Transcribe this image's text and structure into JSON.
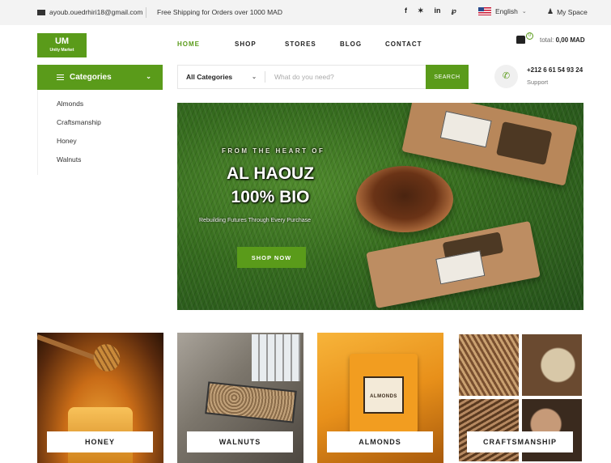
{
  "topbar": {
    "email": "ayoub.ouedrhiri18@gmail.com",
    "shipping": "Free Shipping for Orders over 1000 MAD",
    "social": [
      {
        "name": "facebook-icon",
        "glyph": "f"
      },
      {
        "name": "twitter-icon",
        "glyph": "✶"
      },
      {
        "name": "linkedin-icon",
        "glyph": "in"
      },
      {
        "name": "pinterest-icon",
        "glyph": "℘"
      }
    ],
    "language": "English",
    "account": "My Space"
  },
  "logo": {
    "mark": "UM",
    "name": "Unity Market"
  },
  "nav": [
    {
      "label": "HOME",
      "active": true
    },
    {
      "label": "SHOP",
      "active": false
    },
    {
      "label": "STORES",
      "active": false
    },
    {
      "label": "BLOG",
      "active": false
    },
    {
      "label": "CONTACT",
      "active": false
    }
  ],
  "cart": {
    "count": "0",
    "total_label": "total:",
    "total_value": "0,00 MAD"
  },
  "categories": {
    "title": "Categories",
    "items": [
      "Almonds",
      "Craftsmanship",
      "Honey",
      "Walnuts"
    ]
  },
  "search": {
    "category": "All Categories",
    "placeholder": "What do you need?",
    "button": "SEARCH"
  },
  "support": {
    "phone": "+212 6 61 54 93 24",
    "label": "Support"
  },
  "hero": {
    "eyebrow": "FROM THE HEART OF",
    "title_line1": "AL HAOUZ",
    "title_line2": "100% BIO",
    "tagline": "Rebuilding Futures Through Every Purchase",
    "cta": "SHOP NOW"
  },
  "tiles": [
    "HONEY",
    "WALNUTS",
    "ALMONDS",
    "CRAFTSMANSHIP"
  ],
  "tile_bag_label": "ALMONDS",
  "colors": {
    "accent": "#5a9b1a",
    "topbar": "#f3f3f3"
  }
}
